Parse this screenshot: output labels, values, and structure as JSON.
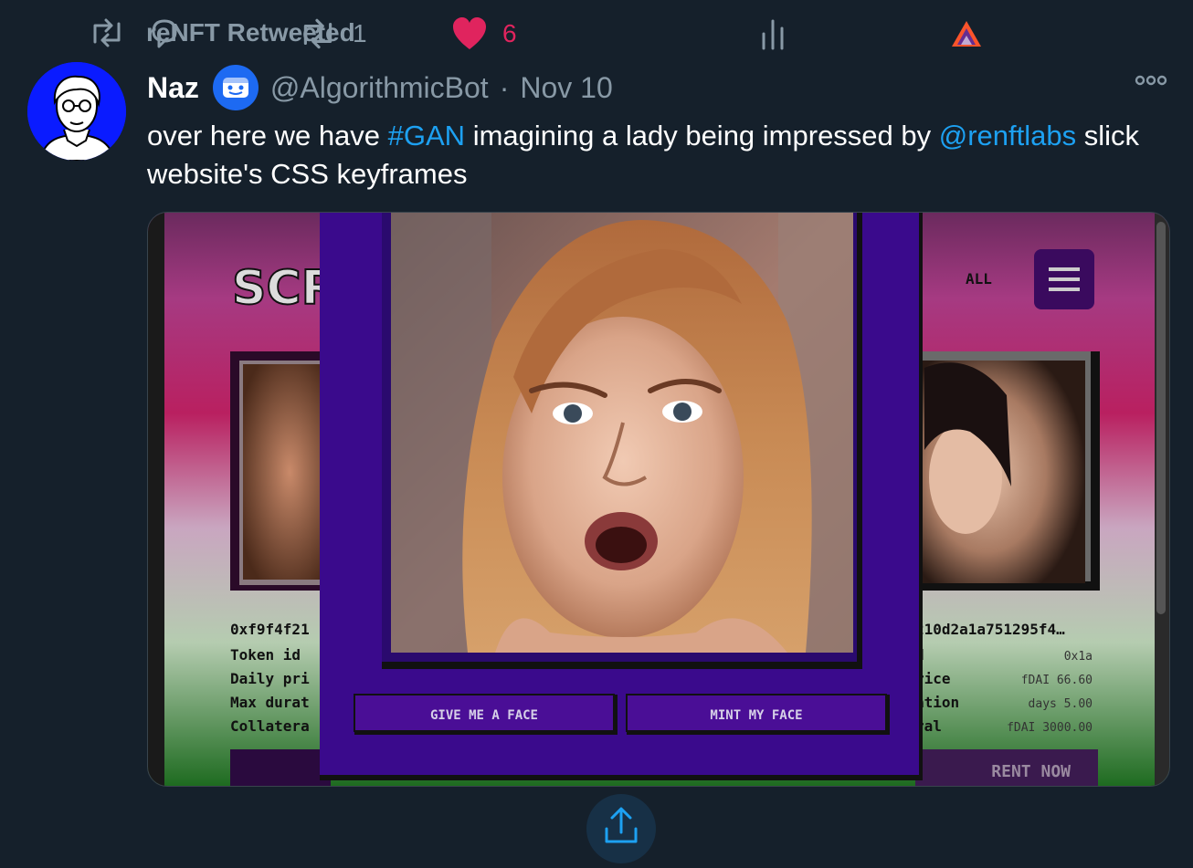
{
  "retweet": {
    "label": "reNFT Retweeted",
    "icon": "retweet-icon"
  },
  "tweet": {
    "name": "Naz",
    "handle": "@AlgorithmicBot",
    "separator": "·",
    "date": "Nov 10",
    "text_part1": "over here we have ",
    "hashtag": "#GAN",
    "text_part2": " imagining a lady being impressed by ",
    "mention": "@renftlabs",
    "text_part3": " slick website's CSS keyframes"
  },
  "media": {
    "logo_text": "SCR",
    "nav_label": "ALL",
    "left_card": {
      "address": "0xf9f4f21",
      "rows": [
        "Token id",
        "Daily pri",
        "Max durat",
        "Collatera"
      ]
    },
    "right_card": {
      "address": "210d2a1a751295f4…",
      "row_labels": [
        "d",
        "rice",
        "ation",
        "ral"
      ],
      "row_values": [
        "0x1a",
        "fDAI 66.60",
        "days 5.00",
        "fDAI 3000.00"
      ],
      "button": "RENT NOW"
    },
    "buttons": {
      "give": "GIVE ME A FACE",
      "mint": "MINT MY FACE"
    }
  },
  "actions": {
    "reply_count": "",
    "retweet_count": "1",
    "like_count": "6"
  },
  "colors": {
    "background": "#15202b",
    "muted": "#8899a6",
    "link": "#1da1f2",
    "like": "#e0245e",
    "modal_purple": "#3a0a8c"
  }
}
